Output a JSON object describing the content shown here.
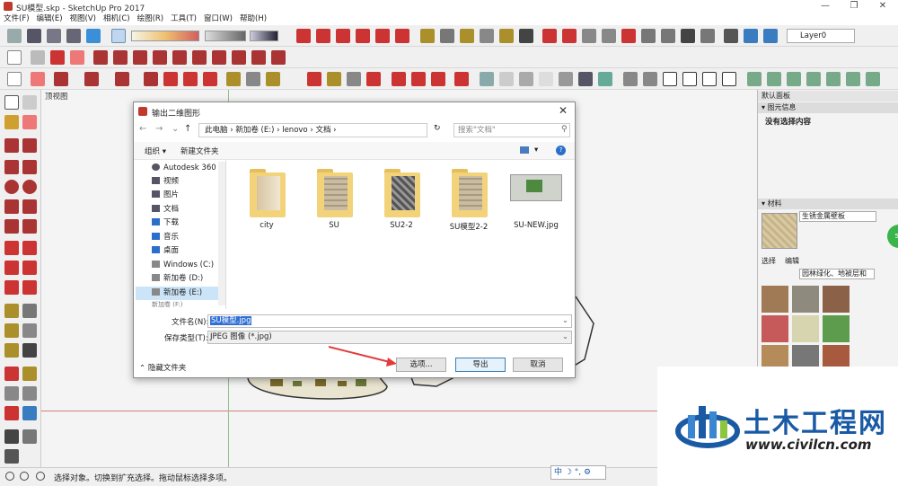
{
  "window": {
    "title": "SU模型.skp - SketchUp Pro 2017"
  },
  "menu": [
    "文件(F)",
    "编辑(E)",
    "视图(V)",
    "相机(C)",
    "绘图(R)",
    "工具(T)",
    "窗口(W)",
    "帮助(H)"
  ],
  "toolbar": {
    "layer_value": "Layer0"
  },
  "viewport": {
    "view_label": "顶视图"
  },
  "dialog": {
    "title": "输出二维图形",
    "breadcrumb": [
      "此电脑",
      "新加卷 (E:)",
      "lenovo",
      "文档"
    ],
    "search_placeholder": "搜索\"文档\"",
    "organize": "组织 ▾",
    "new_folder": "新建文件夹",
    "nav_items": [
      "Autodesk 360",
      "视频",
      "图片",
      "文档",
      "下载",
      "音乐",
      "桌面",
      "Windows (C:)",
      "新加卷 (D:)",
      "新加卷 (E:)",
      "新加卷 (F:)"
    ],
    "files": [
      {
        "name": "city",
        "kind": "folder"
      },
      {
        "name": "SU",
        "kind": "folder"
      },
      {
        "name": "SU2-2",
        "kind": "folder"
      },
      {
        "name": "SU模型2-2",
        "kind": "folder"
      },
      {
        "name": "SU-NEW.jpg",
        "kind": "image"
      }
    ],
    "filename_label": "文件名(N):",
    "filename_value": "SU模型.jpg",
    "filetype_label": "保存类型(T):",
    "filetype_value": "JPEG 图像 (*.jpg)",
    "hide_folders": "隐藏文件夹",
    "options_button": "选项...",
    "export_button": "导出",
    "cancel_button": "取消"
  },
  "right_panel": {
    "tray_title": "默认面板",
    "entity_info_title": "图元信息",
    "entity_info_text": "没有选择内容",
    "materials_title": "材料",
    "material_name": "生锈金属壁板",
    "tab_select": "选择",
    "tab_edit": "编辑",
    "library": "园林绿化、地被层和"
  },
  "status": {
    "text": "选择对象。切换到扩充选择。拖动鼠标选择多项。"
  },
  "ime": {
    "text": "中 ☽ °, ⚙"
  },
  "watermark": {
    "cn": "土木工程网",
    "url": "www.civilcn.com",
    "bubble": "59"
  }
}
